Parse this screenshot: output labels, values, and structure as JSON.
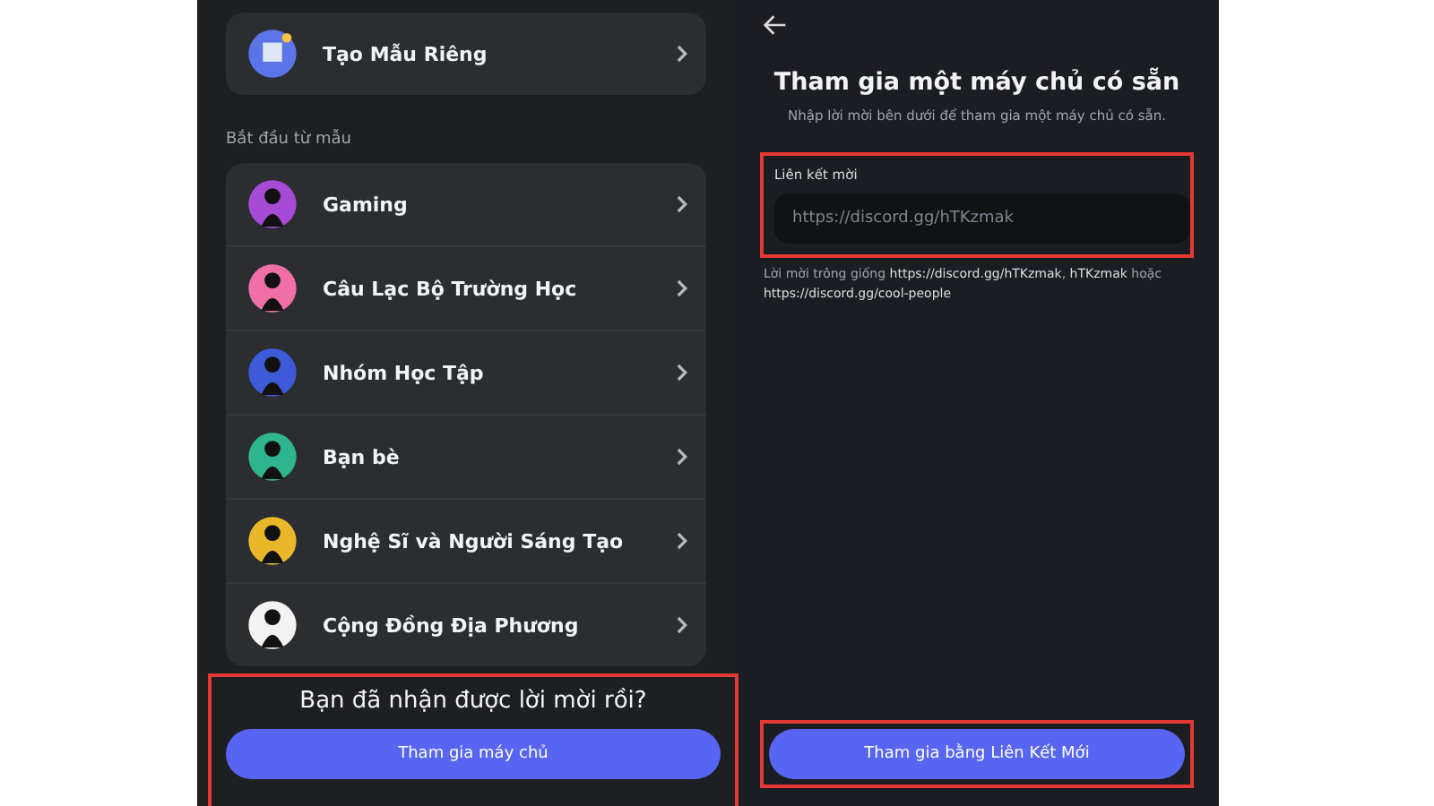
{
  "left_screen": {
    "custom_template": {
      "label": "Tạo Mẫu Riêng"
    },
    "section_title": "Bắt đầu từ mẫu",
    "templates": [
      {
        "label": "Gaming"
      },
      {
        "label": "Câu Lạc Bộ Trường Học"
      },
      {
        "label": "Nhóm Học Tập"
      },
      {
        "label": "Bạn bè"
      },
      {
        "label": "Nghệ Sĩ và Người Sáng Tạo"
      },
      {
        "label": "Cộng Đồng Địa Phương"
      }
    ],
    "invite_prompt": {
      "question": "Bạn đã nhận được lời mời rồi?",
      "button": "Tham gia máy chủ",
      "highlighted": true
    }
  },
  "right_screen": {
    "title": "Tham gia một máy chủ có sẵn",
    "subtitle": "Nhập lời mời bên dưới để tham gia một máy chủ có sẵn.",
    "invite_field": {
      "label": "Liên kết mời",
      "placeholder": "https://discord.gg/hTKzmak",
      "highlighted": true
    },
    "hint": "Lời mời trông giống **https://discord.gg/hTKzmak**, **hTKzmak** hoặc **https://discord.gg/cool-people**",
    "join_button": {
      "label": "Tham gia bằng Liên Kết Mới",
      "highlighted": true
    }
  }
}
